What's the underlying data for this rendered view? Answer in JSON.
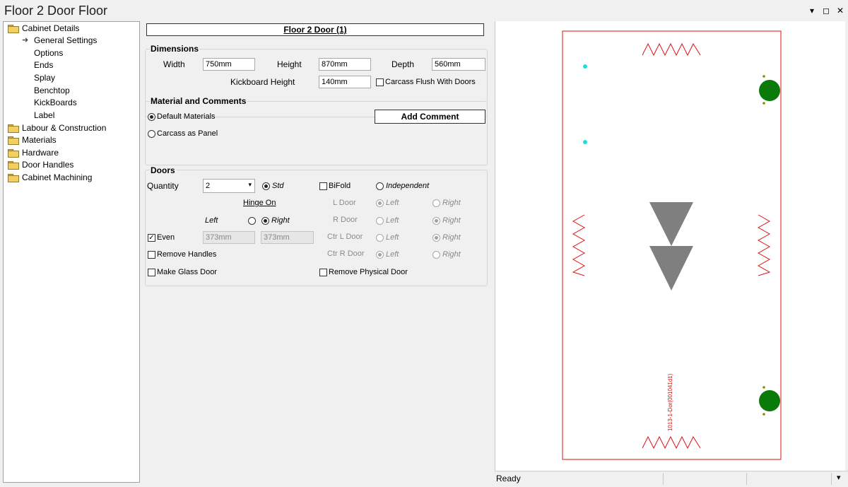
{
  "window": {
    "title": "Floor 2 Door Floor",
    "controls": [
      "▾",
      "◻",
      "✕"
    ]
  },
  "tree": {
    "items": [
      {
        "label": "Cabinet Details",
        "kind": "folder",
        "level": 0
      },
      {
        "label": "General Settings",
        "kind": "arrow",
        "level": 1
      },
      {
        "label": "Options",
        "kind": "leaf",
        "level": 1
      },
      {
        "label": "Ends",
        "kind": "leaf",
        "level": 1
      },
      {
        "label": "Splay",
        "kind": "leaf",
        "level": 1
      },
      {
        "label": "Benchtop",
        "kind": "leaf",
        "level": 1
      },
      {
        "label": "KickBoards",
        "kind": "leaf",
        "level": 1
      },
      {
        "label": "Label",
        "kind": "leaf",
        "level": 1
      },
      {
        "label": "Labour & Construction",
        "kind": "folder",
        "level": 0
      },
      {
        "label": "Materials",
        "kind": "folder",
        "level": 0
      },
      {
        "label": "Hardware",
        "kind": "folder",
        "level": 0
      },
      {
        "label": "Door Handles",
        "kind": "folder",
        "level": 0
      },
      {
        "label": "Cabinet Machining",
        "kind": "folder",
        "level": 0
      }
    ]
  },
  "form": {
    "cabinet_name": "Floor 2 Door (1)",
    "dimensions": {
      "title": "Dimensions",
      "width_label": "Width",
      "width_value": "750mm",
      "height_label": "Height",
      "height_value": "870mm",
      "depth_label": "Depth",
      "depth_value": "560mm",
      "kick_label": "Kickboard Height",
      "kick_value": "140mm",
      "flush_label": "Carcass Flush With Doors"
    },
    "material": {
      "title": "Material and Comments",
      "default_label": "Default Materials",
      "panel_label": "Carcass as Panel",
      "add_comment": "Add Comment"
    },
    "doors": {
      "title": "Doors",
      "quantity_label": "Quantity",
      "quantity_value": "2",
      "std_label": "Std",
      "bifold_label": "BiFold",
      "independent_label": "Independent",
      "hinge_on_label": "Hinge On",
      "left_label": "Left",
      "right_label": "Right",
      "ldoor_label": "L Door",
      "rdoor_label": "R Door",
      "ctrl_label": "Ctr L Door",
      "ctrr_label": "Ctr R Door",
      "even_label": "Even",
      "even_left": "373mm",
      "even_right": "373mm",
      "remove_handles_label": "Remove Handles",
      "glass_label": "Make Glass Door",
      "remove_physical_label": "Remove Physical Door"
    }
  },
  "preview": {
    "vertical_label": "1013-1-Dor(001041d1)",
    "outline_color": "#e01010",
    "hinge_color": "#0a7a0a",
    "marker_color": "#19e0e0",
    "arrow_color": "#7f7f7f"
  },
  "status": {
    "text": "Ready"
  }
}
